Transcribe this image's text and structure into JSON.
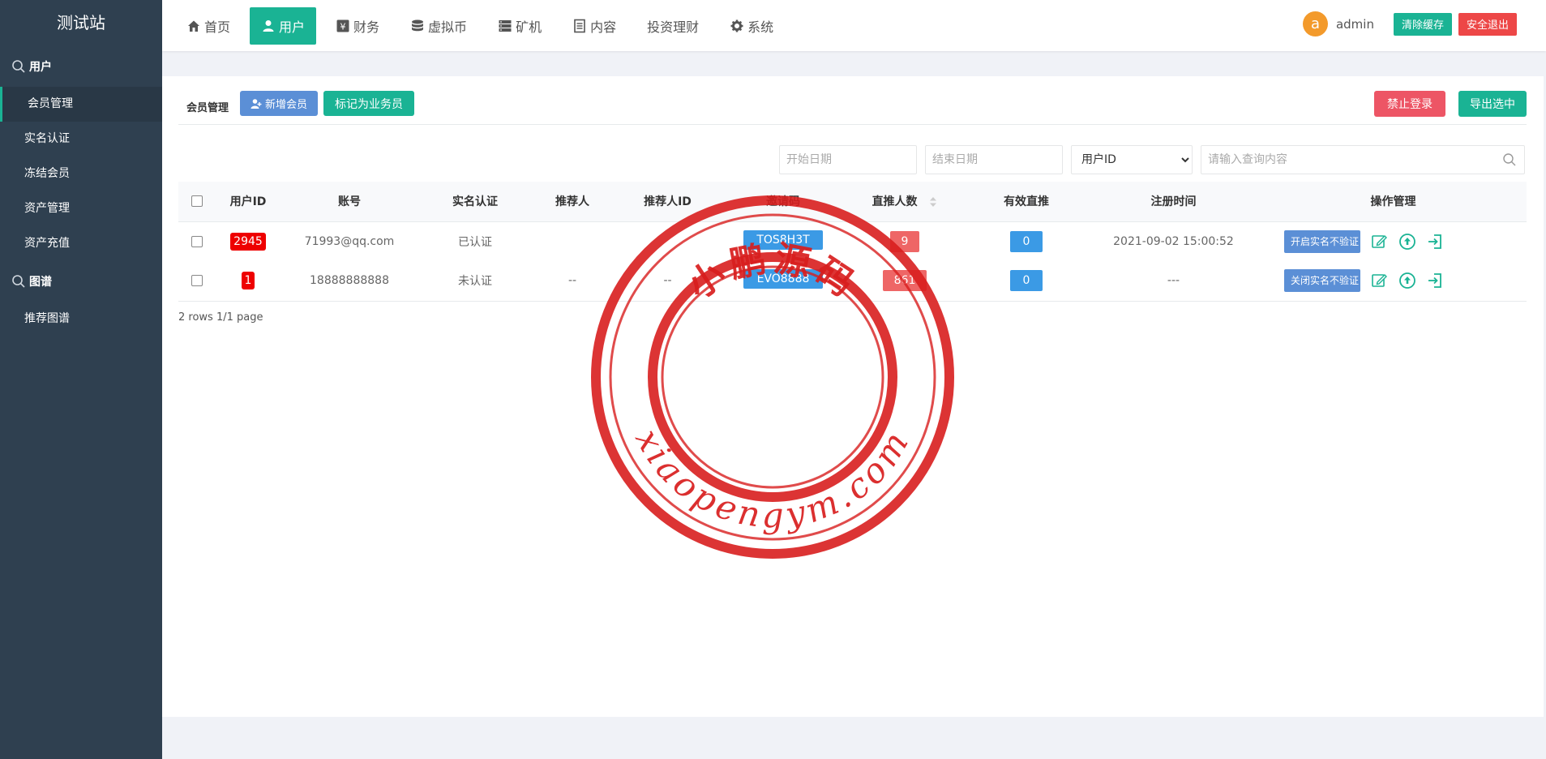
{
  "app": {
    "brand": "测试站"
  },
  "sidebar": {
    "groups": [
      {
        "label": "用户",
        "icon": "search-icon",
        "items": [
          "会员管理",
          "实名认证",
          "冻结会员",
          "资产管理",
          "资产充值"
        ]
      },
      {
        "label": "图谱",
        "icon": "search-icon",
        "items": [
          "推荐图谱"
        ]
      }
    ],
    "active_item": "会员管理"
  },
  "nav": {
    "items": [
      {
        "label": "首页",
        "icon": "home-icon"
      },
      {
        "label": "用户",
        "icon": "user-icon"
      },
      {
        "label": "财务",
        "icon": "yen-icon"
      },
      {
        "label": "虚拟币",
        "icon": "database-icon"
      },
      {
        "label": "矿机",
        "icon": "server-icon"
      },
      {
        "label": "内容",
        "icon": "document-icon"
      },
      {
        "label": "投资理财",
        "icon": ""
      },
      {
        "label": "系统",
        "icon": "gear-icon"
      }
    ],
    "active": "用户"
  },
  "user": {
    "avatar_letter": "a",
    "name": "admin",
    "clear_cache": "清除缓存",
    "logout": "安全退出"
  },
  "toolbar": {
    "title": "会员管理",
    "add_member": "新增会员",
    "mark_salesman": "标记为业务员",
    "ban_login": "禁止登录",
    "export_selected": "导出选中"
  },
  "search": {
    "start_date_placeholder": "开始日期",
    "end_date_placeholder": "结束日期",
    "field_selected": "用户ID",
    "query_placeholder": "请输入查询内容"
  },
  "table": {
    "headers": [
      "用户ID",
      "账号",
      "实名认证",
      "推荐人",
      "推荐人ID",
      "邀请码",
      "直推人数",
      "有效直推",
      "注册时间",
      "操作管理"
    ],
    "rows": [
      {
        "id": "2945",
        "account": "71993@qq.com",
        "verified": "已认证",
        "referrer": "",
        "referrer_id": "",
        "invite_code": "TOS8H3T",
        "direct": "9",
        "valid_direct": "0",
        "reg_time": "2021-09-02 15:00:52",
        "op_label": "开启实名不验证"
      },
      {
        "id": "1",
        "account": "18888888888",
        "verified": "未认证",
        "referrer": "--",
        "referrer_id": "--",
        "invite_code": "EVO8888",
        "direct": "861",
        "valid_direct": "0",
        "reg_time": "---",
        "op_label": "关闭实名不验证"
      }
    ]
  },
  "pager": {
    "text": "2 rows 1/1 page"
  },
  "watermark": {
    "top_text": "小鹏源码",
    "bottom_text": "xiaopengym.com"
  },
  "colors": {
    "sidebar": "#2f4050",
    "accent": "#1ab394",
    "blue": "#5b8fd6",
    "danger": "#ed5565",
    "id_badge": "#ee0000",
    "seal": "#d81e1e"
  }
}
